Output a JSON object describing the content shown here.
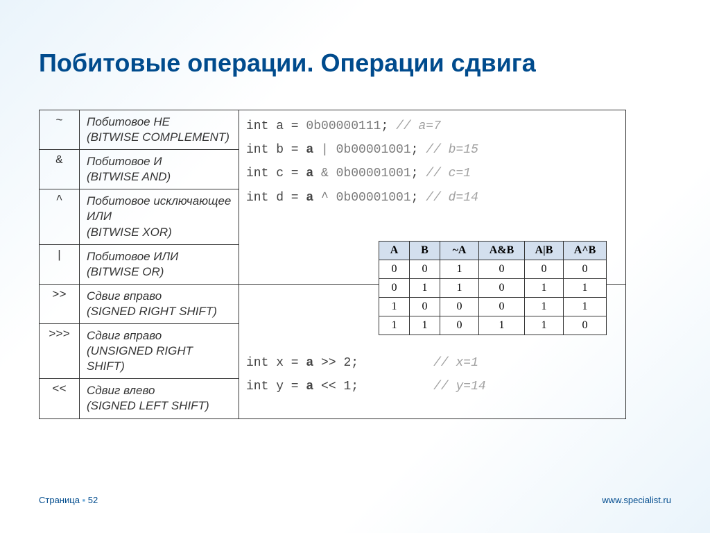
{
  "title": "Побитовые операции. Операции сдвига",
  "operators": [
    {
      "sym": "~",
      "name": "Побитовое НЕ",
      "eng": "(BITWISE COMPLEMENT)"
    },
    {
      "sym": "&",
      "name": "Побитовое И",
      "eng": "(BITWISE AND)"
    },
    {
      "sym": "^",
      "name": "Побитовое исключающее ИЛИ",
      "eng": "(BITWISE XOR)"
    },
    {
      "sym": "|",
      "name": "Побитовое ИЛИ",
      "eng": "(BITWISE OR)"
    },
    {
      "sym": ">>",
      "name": "Сдвиг вправо",
      "eng": "(SIGNED RIGHT SHIFT)"
    },
    {
      "sym": ">>>",
      "name": "Сдвиг вправо",
      "eng": "(UNSIGNED RIGHT SHIFT)"
    },
    {
      "sym": "<<",
      "name": "Сдвиг влево",
      "eng": "(SIGNED LEFT SHIFT)"
    }
  ],
  "code1": {
    "l1a": "int a =     ",
    "l1b": "0b00000111",
    "l1c": "; ",
    "l1d": "// a=7",
    "l2a": "int b = ",
    "l2var": "a",
    "l2b": " | 0b00001001",
    "l2c": "; ",
    "l2d": "// b=15",
    "l3a": "int c = ",
    "l3var": "a",
    "l3b": " & 0b00001001",
    "l3c": "; ",
    "l3d": "// c=1",
    "l4a": "int d = ",
    "l4var": "a",
    "l4b": " ^ 0b00001001",
    "l4c": "; ",
    "l4d": "// d=14"
  },
  "code2": {
    "l1a": "int x = ",
    "l1var": "a",
    "l1b": " >> 2;          ",
    "l1c": "// x=1",
    "l2a": "int y = ",
    "l2var": "a",
    "l2b": " << 1;          ",
    "l2c": "// y=14"
  },
  "truth": {
    "headers": [
      "A",
      "B",
      "~A",
      "A&B",
      "A|B",
      "A^B"
    ],
    "rows": [
      [
        "0",
        "0",
        "1",
        "0",
        "0",
        "0"
      ],
      [
        "0",
        "1",
        "1",
        "0",
        "1",
        "1"
      ],
      [
        "1",
        "0",
        "0",
        "0",
        "1",
        "1"
      ],
      [
        "1",
        "1",
        "0",
        "1",
        "1",
        "0"
      ]
    ]
  },
  "footer": {
    "page_label": "Страница",
    "page_num": "52",
    "url": "www.specialist.ru"
  }
}
